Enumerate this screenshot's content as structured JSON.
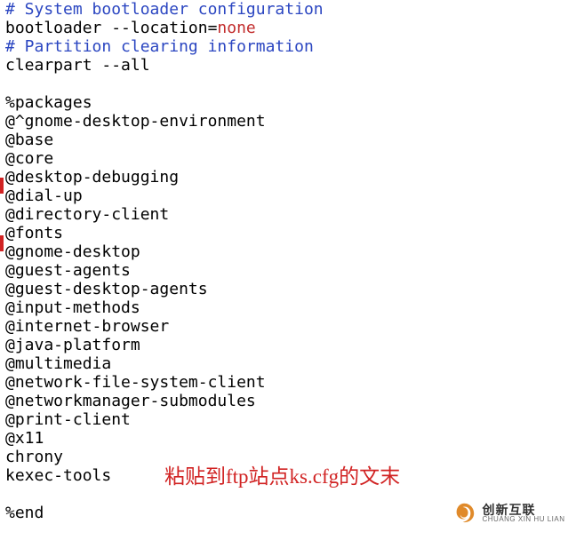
{
  "code": {
    "comment1": "# System bootloader configuration",
    "bootloader_prefix": "bootloader --location=",
    "bootloader_value": "none",
    "comment2": "# Partition clearing information",
    "clearpart": "clearpart --all",
    "blank1": "",
    "packages_header": "%packages",
    "pkg1": "@^gnome-desktop-environment",
    "pkg2": "@base",
    "pkg3": "@core",
    "pkg4": "@desktop-debugging",
    "pkg5": "@dial-up",
    "pkg6": "@directory-client",
    "pkg7": "@fonts",
    "pkg8": "@gnome-desktop",
    "pkg9": "@guest-agents",
    "pkg10": "@guest-desktop-agents",
    "pkg11": "@input-methods",
    "pkg12": "@internet-browser",
    "pkg13": "@java-platform",
    "pkg14": "@multimedia",
    "pkg15": "@network-file-system-client",
    "pkg16": "@networkmanager-submodules",
    "pkg17": "@print-client",
    "pkg18": "@x11",
    "pkg19": "chrony",
    "pkg20": "kexec-tools",
    "blank2": "",
    "end": "%end"
  },
  "annotation": "粘贴到ftp站点ks.cfg的文末",
  "watermark": {
    "cn": "创新互联",
    "en": "CHUANG XIN HU LIAN"
  }
}
